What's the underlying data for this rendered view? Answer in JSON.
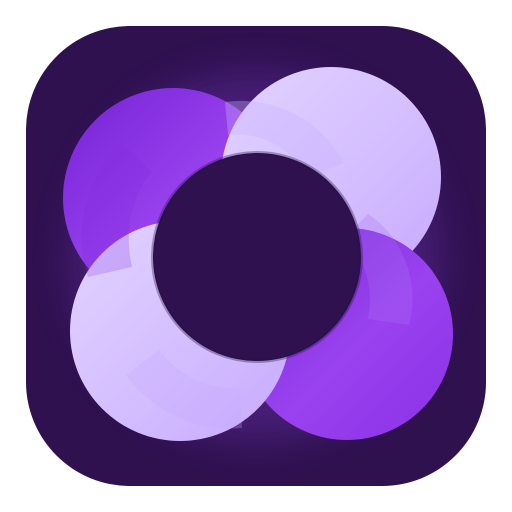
{
  "app_icon": {
    "icon_name": "app-icon",
    "logo_name": "overlapping-rings-logo",
    "colors": {
      "background": "#2f1150",
      "background_edge": "#29104a",
      "dark_purple": "#8e35e7",
      "dark_purple_shadow": "#7420d1",
      "light_purple": "#d7c2ff",
      "light_purple_shadow": "#bfa1fb",
      "center_hole": "#2f1150",
      "glow": "#7b42c4"
    }
  }
}
